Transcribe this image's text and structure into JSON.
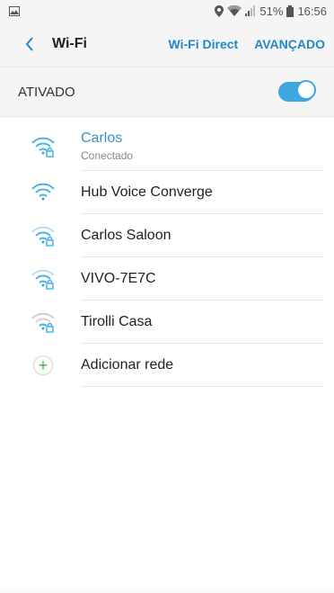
{
  "status_bar": {
    "battery": "51%",
    "time": "16:56",
    "icons": [
      "image-icon",
      "location-icon",
      "wifi-icon",
      "signal-icon",
      "battery-icon"
    ]
  },
  "action_bar": {
    "title": "Wi-Fi",
    "wifi_direct": "Wi-Fi Direct",
    "advanced": "AVANÇADO"
  },
  "master_switch": {
    "label": "ATIVADO",
    "state": "on"
  },
  "networks": [
    {
      "name": "Carlos",
      "status": "Conectado",
      "secured": true,
      "connected": true,
      "strength": "strong"
    },
    {
      "name": "Hub Voice Converge",
      "status": "",
      "secured": false,
      "connected": false,
      "strength": "strong"
    },
    {
      "name": "Carlos Saloon",
      "status": "",
      "secured": true,
      "connected": false,
      "strength": "medium"
    },
    {
      "name": "VIVO-7E7C",
      "status": "",
      "secured": true,
      "connected": false,
      "strength": "medium"
    },
    {
      "name": "Tirolli Casa",
      "status": "",
      "secured": true,
      "connected": false,
      "strength": "weak"
    }
  ],
  "add_network": {
    "label": "Adicionar rede",
    "icon": "+"
  },
  "colors": {
    "accent": "#1e88c8",
    "connected_text": "#3b8fc4",
    "toggle": "#3ea6e0",
    "add_plus": "#3aae4a"
  }
}
